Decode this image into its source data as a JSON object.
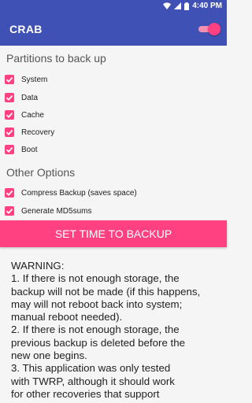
{
  "status_bar": {
    "time": "4:40",
    "time_suffix": "PM"
  },
  "app_bar": {
    "title": "CRAB",
    "toggle_on": true
  },
  "partitions": {
    "title": "Partitions to back up",
    "items": [
      {
        "label": "System",
        "checked": true
      },
      {
        "label": "Data",
        "checked": true
      },
      {
        "label": "Cache",
        "checked": true
      },
      {
        "label": "Recovery",
        "checked": true
      },
      {
        "label": "Boot",
        "checked": true
      }
    ]
  },
  "other_options": {
    "title": "Other Options",
    "items": [
      {
        "label": "Compress Backup (saves space)",
        "checked": true
      },
      {
        "label": "Generate MD5sums",
        "checked": true
      }
    ]
  },
  "set_time_button": {
    "label": "SET TIME TO BACKUP"
  },
  "warning": {
    "lines": [
      "WARNING:",
      " 1. If there is not enough storage, the",
      "backup will not be made (if this happens,",
      "may will not reboot back into system;",
      "manual reboot needed).",
      " 2. If there is not enough storage, the",
      "previous backup is deleted before the",
      "new one begins.",
      " 3. This application was only tested",
      "with TWRP, although it should work",
      "for other recoveries that support"
    ]
  },
  "colors": {
    "primary": "#3f51b5",
    "accent": "#ff4081",
    "background": "#f5f5f5"
  }
}
